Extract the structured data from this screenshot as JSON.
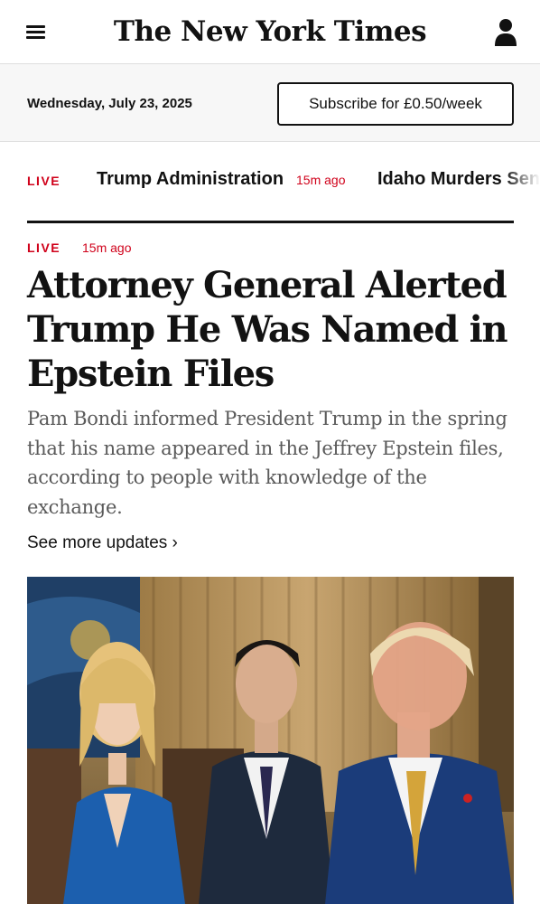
{
  "header": {
    "logo_text": "The New York Times",
    "menu_icon": "hamburger-menu-icon",
    "account_icon": "user-account-icon"
  },
  "subheader": {
    "date": "Wednesday, July 23, 2025",
    "subscribe_label": "Subscribe for £0.50/week"
  },
  "ticker": {
    "live_label": "LIVE",
    "items": [
      {
        "label": "Trump Administration",
        "time": "15m ago"
      },
      {
        "label": "Idaho Murders Sentencing"
      }
    ]
  },
  "article": {
    "live_label": "LIVE",
    "time": "15m ago",
    "headline": "Attorney General Alerted Trump He Was Named in Epstein Files",
    "summary": "Pam Bondi informed President Trump in the spring that his name appeared in the Jeffrey Epstein files, according to people with knowledge of the exchange.",
    "more_link": "See more updates ›"
  },
  "colors": {
    "accent_live": "#d0021b",
    "text": "#121212",
    "summary_text": "#5a5a5a",
    "subheader_bg": "#f7f7f7"
  }
}
